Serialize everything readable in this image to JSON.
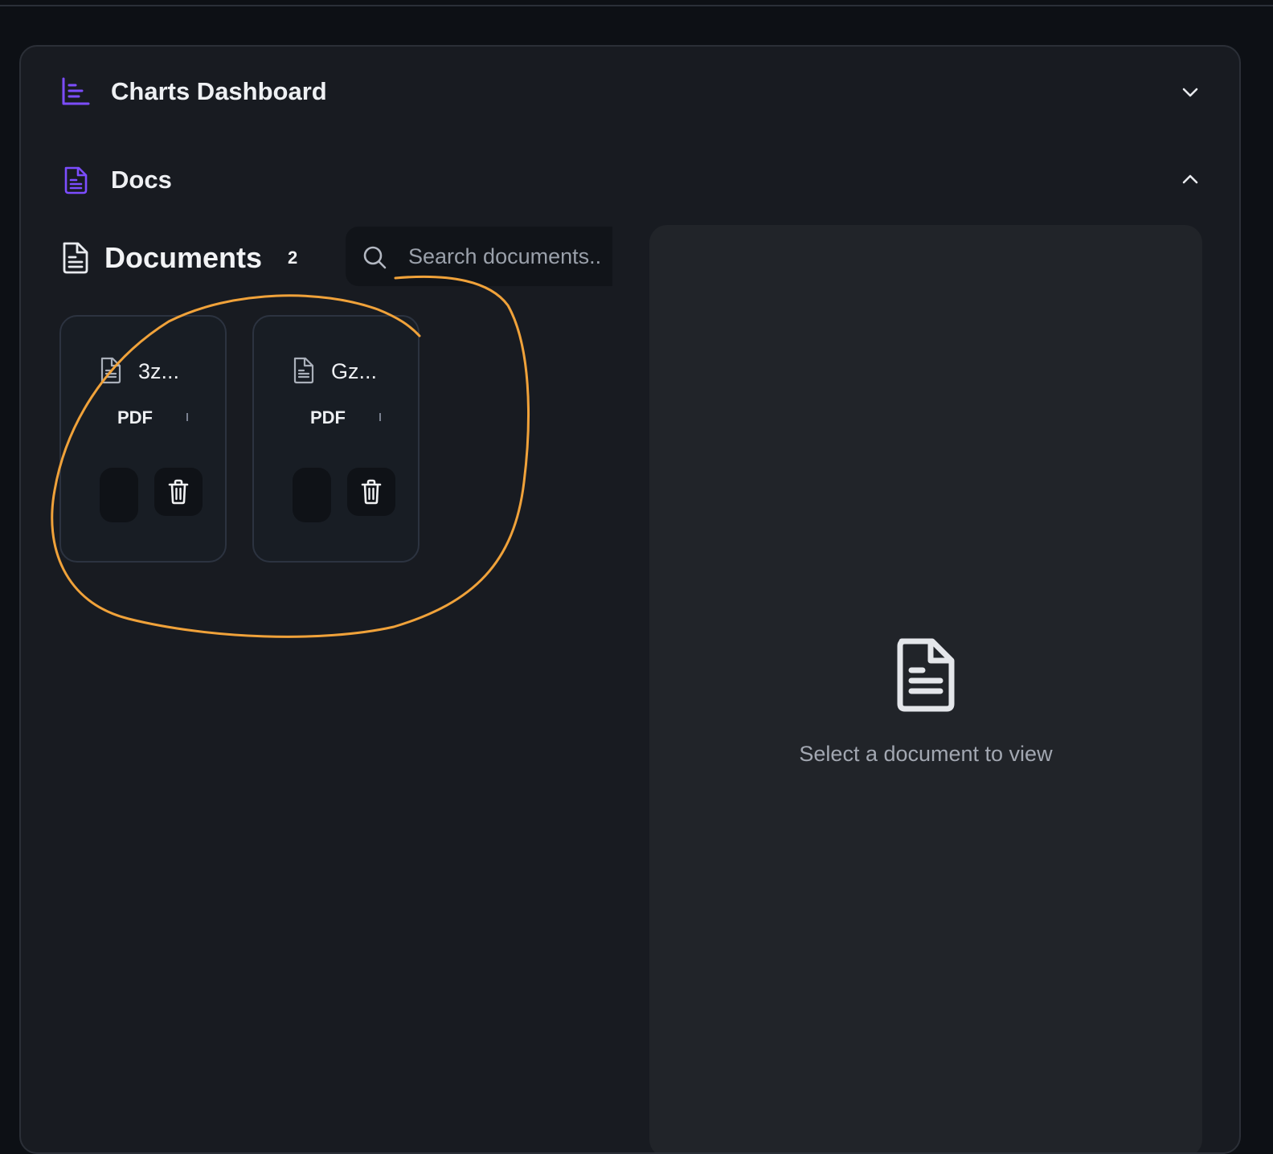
{
  "sections": [
    {
      "title": "Charts Dashboard",
      "icon": "bar-chart-icon",
      "state": "collapsed"
    },
    {
      "title": "Docs",
      "icon": "document-icon",
      "state": "expanded"
    }
  ],
  "documents_panel": {
    "title": "Documents",
    "count": "2",
    "search": {
      "placeholder": "Search documents..",
      "value": ""
    },
    "items": [
      {
        "name": "3z...",
        "type": "PDF"
      },
      {
        "name": "Gz...",
        "type": "PDF"
      }
    ]
  },
  "viewer": {
    "empty_message": "Select a document to view"
  },
  "colors": {
    "accent": "#7c4dff",
    "annotation": "#f0a23a",
    "panel_bg": "#181b21",
    "viewer_bg": "#212429"
  }
}
